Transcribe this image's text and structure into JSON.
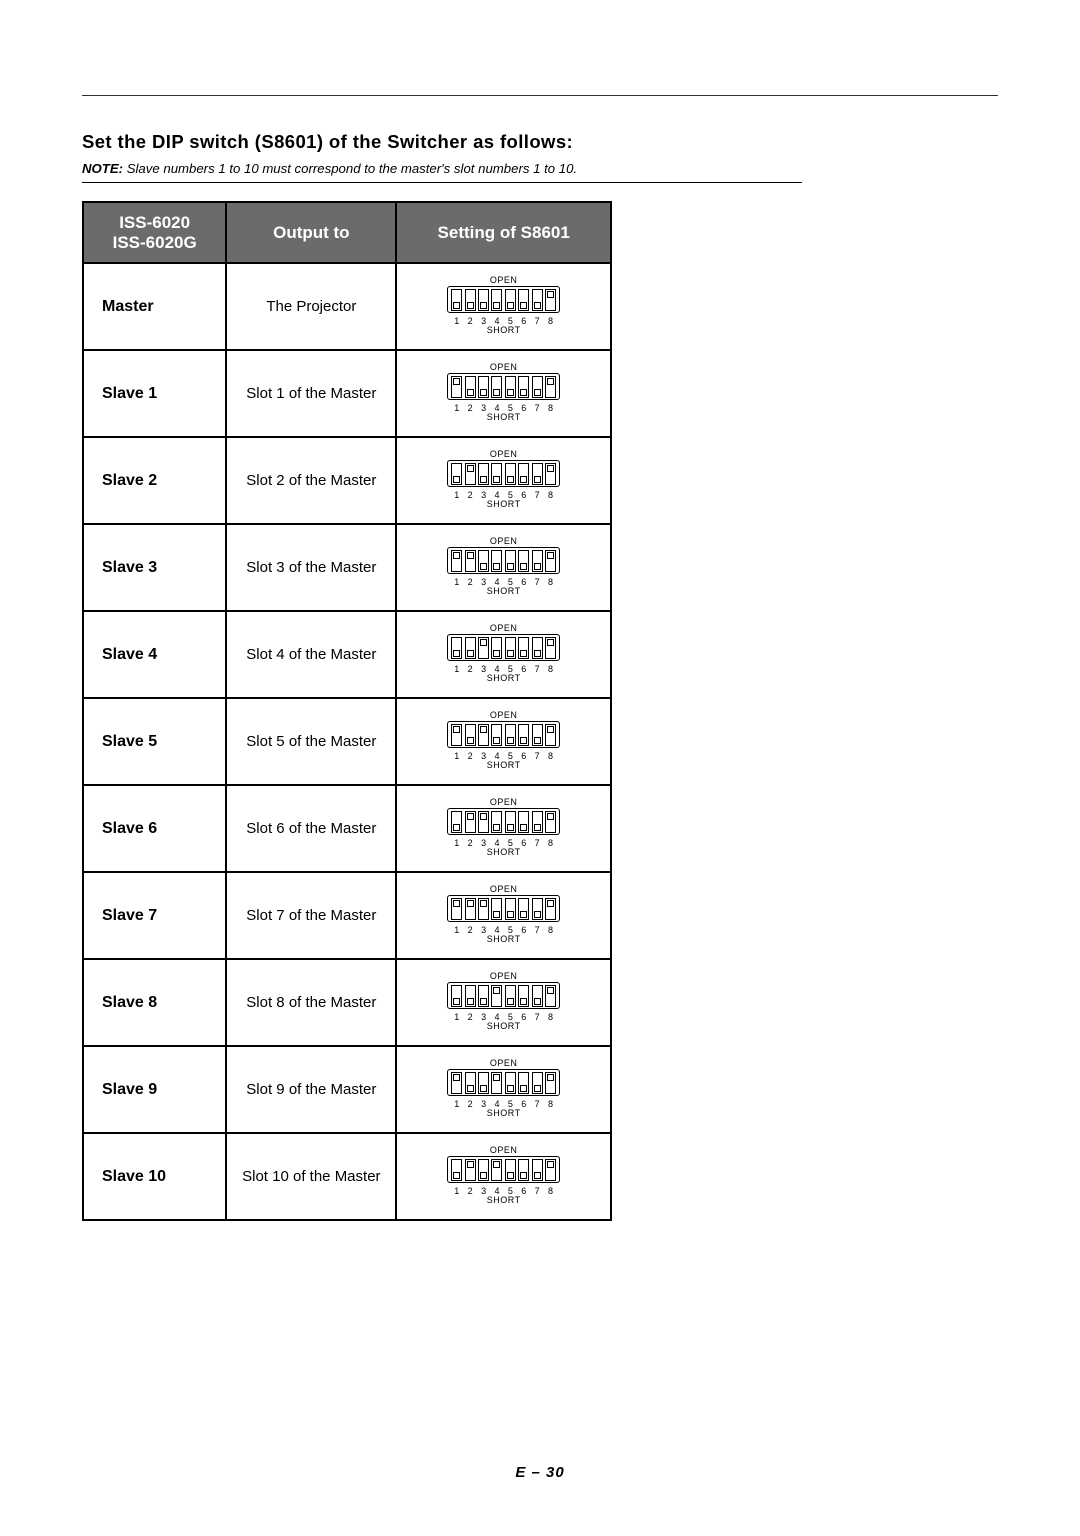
{
  "heading": "Set the DIP switch (S8601) of the Switcher as follows:",
  "note_bold": "NOTE:",
  "note_text": "Slave numbers 1 to 10 must correspond to the master's slot numbers 1 to 10.",
  "columns": {
    "c1a": "ISS-6020",
    "c1b": "ISS-6020G",
    "c2": "Output to",
    "c3": "Setting of S8601"
  },
  "dip_labels": {
    "open": "OPEN",
    "short": "SHORT"
  },
  "dip_numbers": [
    "1",
    "2",
    "3",
    "4",
    "5",
    "6",
    "7",
    "8"
  ],
  "rows": [
    {
      "name": "Master",
      "output": "The Projector",
      "sw": [
        0,
        0,
        0,
        0,
        0,
        0,
        0,
        1
      ]
    },
    {
      "name": "Slave 1",
      "output": "Slot 1 of the Master",
      "sw": [
        1,
        0,
        0,
        0,
        0,
        0,
        0,
        1
      ]
    },
    {
      "name": "Slave 2",
      "output": "Slot 2 of the Master",
      "sw": [
        0,
        1,
        0,
        0,
        0,
        0,
        0,
        1
      ]
    },
    {
      "name": "Slave 3",
      "output": "Slot 3 of the Master",
      "sw": [
        1,
        1,
        0,
        0,
        0,
        0,
        0,
        1
      ]
    },
    {
      "name": "Slave 4",
      "output": "Slot 4 of the Master",
      "sw": [
        0,
        0,
        1,
        0,
        0,
        0,
        0,
        1
      ]
    },
    {
      "name": "Slave 5",
      "output": "Slot 5 of the Master",
      "sw": [
        1,
        0,
        1,
        0,
        0,
        0,
        0,
        1
      ]
    },
    {
      "name": "Slave 6",
      "output": "Slot 6 of the Master",
      "sw": [
        0,
        1,
        1,
        0,
        0,
        0,
        0,
        1
      ]
    },
    {
      "name": "Slave 7",
      "output": "Slot 7 of the Master",
      "sw": [
        1,
        1,
        1,
        0,
        0,
        0,
        0,
        1
      ]
    },
    {
      "name": "Slave 8",
      "output": "Slot 8 of the Master",
      "sw": [
        0,
        0,
        0,
        1,
        0,
        0,
        0,
        1
      ]
    },
    {
      "name": "Slave 9",
      "output": "Slot 9 of the Master",
      "sw": [
        1,
        0,
        0,
        1,
        0,
        0,
        0,
        1
      ]
    },
    {
      "name": "Slave 10",
      "output": "Slot 10 of the Master",
      "sw": [
        0,
        1,
        0,
        1,
        0,
        0,
        0,
        1
      ]
    }
  ],
  "page_number": "E – 30"
}
